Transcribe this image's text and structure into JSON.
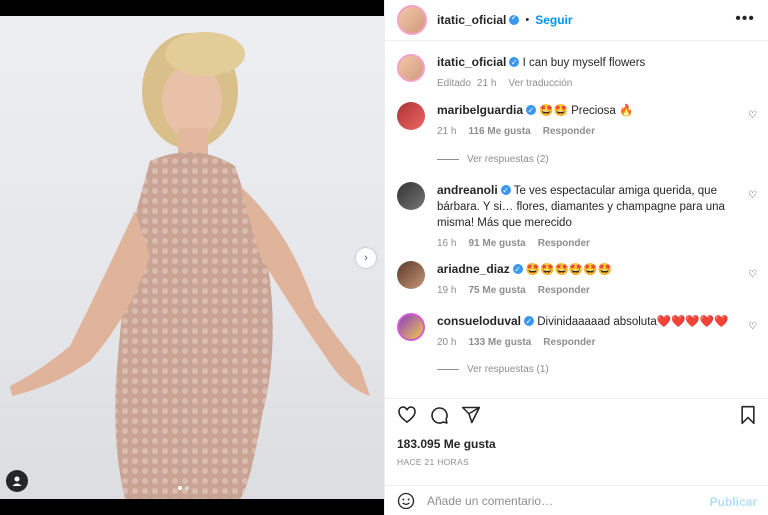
{
  "post": {
    "username": "itatic_oficial",
    "follow_label": "Seguir",
    "more_label": "•••",
    "caption": "I can buy myself flowers",
    "caption_meta": {
      "edited": "Editado",
      "time": "21 h",
      "translate": "Ver traducción"
    }
  },
  "comments": [
    {
      "user": "maribelguardia",
      "text": "🤩🤩 Preciosa 🔥",
      "time": "21 h",
      "likes": "116 Me gusta",
      "reply": "Responder",
      "view_replies": "Ver respuestas (2)"
    },
    {
      "user": "andreanoli",
      "text": "Te ves espectacular amiga querida, que bárbara. Y si… flores, diamantes y champagne para una misma! Más que merecido",
      "time": "16 h",
      "likes": "91 Me gusta",
      "reply": "Responder"
    },
    {
      "user": "ariadne_diaz",
      "text": "🤩🤩🤩🤩🤩🤩",
      "time": "19 h",
      "likes": "75 Me gusta",
      "reply": "Responder"
    },
    {
      "user": "consueloduval",
      "text": "Divinidaaaaad absoluta❤️❤️❤️❤️❤️",
      "time": "20 h",
      "likes": "133 Me gusta",
      "reply": "Responder",
      "view_replies": "Ver respuestas (1)"
    }
  ],
  "stats": {
    "likes": "183.095 Me gusta",
    "ago": "HACE 21 HORAS"
  },
  "composer": {
    "placeholder": "Añade un comentario…",
    "publish": "Publicar"
  },
  "icons": [
    "heart-icon",
    "comment-icon",
    "share-icon",
    "bookmark-icon",
    "emoji-icon",
    "user-tag-icon",
    "chevron-right-icon",
    "verified-icon"
  ],
  "colors": {
    "link": "#0095f6",
    "verified": "#3897f0",
    "muted": "#8e8e8e",
    "publish_disabled": "#b2dffc"
  }
}
